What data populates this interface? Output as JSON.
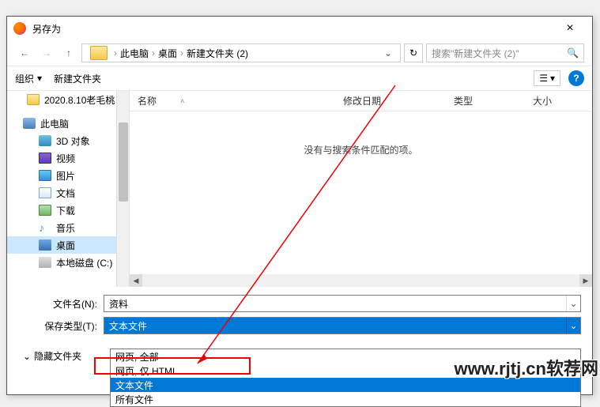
{
  "window": {
    "title": "另存为",
    "close": "×"
  },
  "nav": {
    "path": [
      "此电脑",
      "桌面",
      "新建文件夹 (2)"
    ],
    "search_placeholder": "搜索\"新建文件夹 (2)\""
  },
  "toolbar": {
    "organize": "组织",
    "new_folder": "新建文件夹"
  },
  "tree": {
    "folder_special": "2020.8.10老毛桃",
    "pc": "此电脑",
    "items": [
      {
        "icon": "ic-3d",
        "label": "3D 对象"
      },
      {
        "icon": "ic-video",
        "label": "视频"
      },
      {
        "icon": "ic-image",
        "label": "图片"
      },
      {
        "icon": "ic-doc",
        "label": "文档"
      },
      {
        "icon": "ic-download",
        "label": "下载"
      },
      {
        "icon": "ic-music",
        "label": "音乐"
      },
      {
        "icon": "ic-desktop",
        "label": "桌面",
        "selected": true
      },
      {
        "icon": "ic-disk",
        "label": "本地磁盘 (C:)"
      }
    ]
  },
  "columns": {
    "name": "名称",
    "modified": "修改日期",
    "type": "类型",
    "size": "大小"
  },
  "empty_msg": "没有与搜索条件匹配的项。",
  "filename": {
    "label": "文件名(N):",
    "value": "资料"
  },
  "filetype": {
    "label": "保存类型(T):",
    "value": "文本文件",
    "options": [
      "网页, 全部",
      "网页, 仅 HTML",
      "文本文件",
      "所有文件"
    ],
    "highlighted_index": 2
  },
  "hide_folders": "隐藏文件夹",
  "watermark": "www.rjtj.cn软荐网"
}
